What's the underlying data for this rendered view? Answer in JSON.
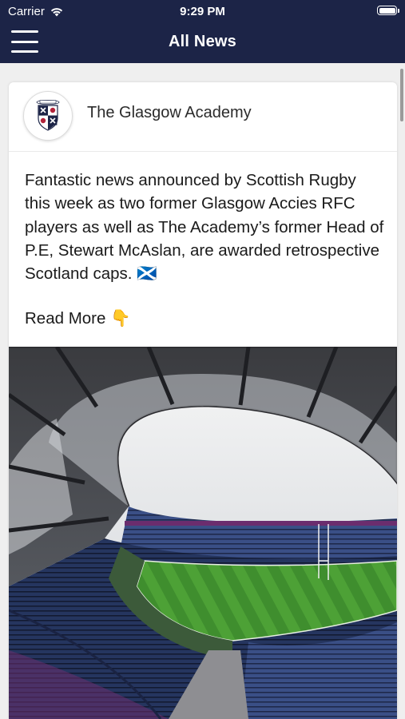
{
  "status_bar": {
    "carrier": "Carrier",
    "time": "9:29 PM",
    "icons": [
      "wifi-icon",
      "battery-icon"
    ]
  },
  "nav": {
    "title": "All News",
    "menu_icon": "hamburger-menu-icon",
    "background": "#1c2447"
  },
  "post": {
    "source": "The Glasgow Academy",
    "text": "Fantastic news announced by Scottish Rugby this week as two former Glasgow Accies RFC players as well as The Academy’s former Head of P.E, Stewart McAslan, are awarded retrospective Scotland caps. 🏴󠁧󠁢󠁳󠁣󠁴󠁿",
    "read_more": "Read More 👇",
    "image": "rugby-stadium-photo"
  }
}
